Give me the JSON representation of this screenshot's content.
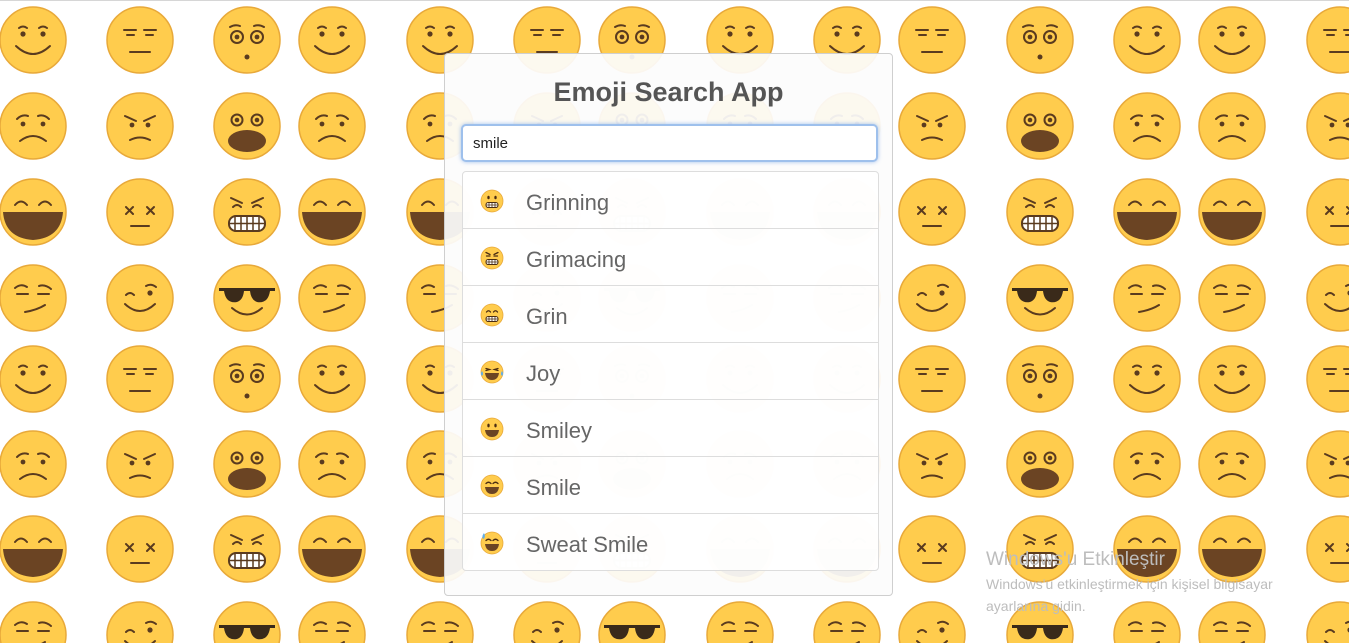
{
  "app": {
    "title": "Emoji Search App"
  },
  "search": {
    "value": "smile",
    "placeholder": ""
  },
  "results": [
    {
      "label": "Grinning",
      "icon": "grinning-face-icon"
    },
    {
      "label": "Grimacing",
      "icon": "grimacing-face-icon"
    },
    {
      "label": "Grin",
      "icon": "grin-face-icon"
    },
    {
      "label": "Joy",
      "icon": "joy-face-icon"
    },
    {
      "label": "Smiley",
      "icon": "smiley-face-icon"
    },
    {
      "label": "Smile",
      "icon": "smile-face-icon"
    },
    {
      "label": "Sweat Smile",
      "icon": "sweat-smile-face-icon"
    }
  ],
  "background": {
    "pattern_faces": [
      "smiling",
      "expressionless",
      "astonished",
      "smiling",
      "frowning",
      "angry",
      "screaming",
      "frowning",
      "grinning",
      "dizzy",
      "grimacing",
      "grinning",
      "smirking",
      "winking",
      "sunglasses",
      "smirking"
    ]
  },
  "watermark": {
    "title": "Windows'u Etkinleştir",
    "line1": "Windows'u etkinleştirmek için kişisel bilgisayar",
    "line2": "ayarlarına gidin."
  },
  "colors": {
    "emoji_fill": "#FFCC4D",
    "emoji_stroke": "#E8A93A",
    "mouth_brown": "#6B4423",
    "search_focus": "#9EC0EC"
  }
}
